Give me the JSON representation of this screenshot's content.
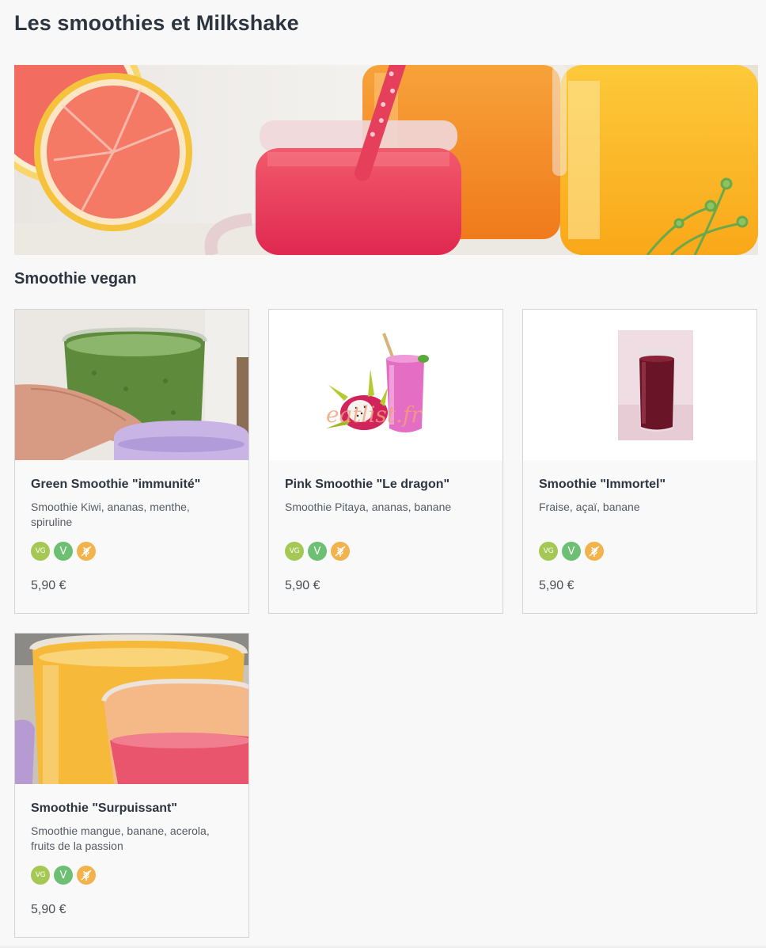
{
  "page": {
    "title": "Les smoothies et Milkshake",
    "hero_image": "smoothies-hero-photo"
  },
  "section": {
    "title": "Smoothie vegan"
  },
  "badges": {
    "vegan": "VG",
    "vegetarian": "V",
    "gluten_free_icon": "wheat-crossed-icon"
  },
  "colors": {
    "vegan_badge": "#a5c855",
    "vegetarian_badge": "#6dbf74",
    "gluten_free_badge": "#f2b24c"
  },
  "products": [
    {
      "name": "Green Smoothie \"immunité\"",
      "description": "Smoothie Kiwi, ananas, menthe, spiruline",
      "price": "5,90 €",
      "image": "green-smoothie-photo"
    },
    {
      "name": "Pink Smoothie \"Le dragon\"",
      "description": "Smoothie Pitaya, ananas, banane",
      "price": "5,90 €",
      "image": "pink-pitaya-smoothie-photo",
      "watermark": "eatlist.fr"
    },
    {
      "name": "Smoothie \"Immortel\"",
      "description": "Fraise, açaï, banane",
      "price": "5,90 €",
      "image": "red-acai-smoothie-photo"
    },
    {
      "name": "Smoothie \"Surpuissant\"",
      "description": "Smoothie mangue, banane, acerola, fruits de la passion",
      "price": "5,90 €",
      "image": "mango-smoothie-photo"
    }
  ]
}
